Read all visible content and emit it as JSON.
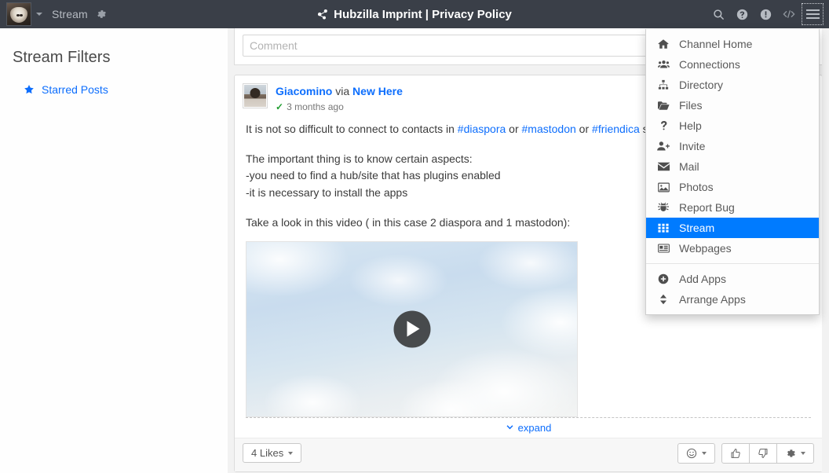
{
  "header": {
    "brand_avatar_alt": "channel-avatar",
    "nav_label": "Stream",
    "gear_icon": "gear-icon",
    "caret_icon": "caret-down-icon",
    "title": "Hubzilla Imprint | Privacy Policy",
    "title_icon": "share-nodes-icon",
    "icons": [
      {
        "name": "search-icon",
        "glyph": "search"
      },
      {
        "name": "help-icon",
        "glyph": "question-circle"
      },
      {
        "name": "info-icon",
        "glyph": "exclamation-circle"
      },
      {
        "name": "code-icon",
        "glyph": "code"
      },
      {
        "name": "hamburger-menu-icon",
        "glyph": "bars"
      }
    ],
    "bg_color": "#3a3f48",
    "text_color": "#b6bbc2"
  },
  "sidebar": {
    "title": "Stream Filters",
    "items": [
      {
        "label": "Starred Posts",
        "icon": "star-icon",
        "icon_color": "#0d6efd"
      }
    ]
  },
  "comment_box": {
    "placeholder": "Comment",
    "value": ""
  },
  "post": {
    "author": "Giacomino",
    "via_text": "via",
    "source": "New Here",
    "verified_icon": "check-icon",
    "timestamp": "3 months ago",
    "body": {
      "line1_prefix": "It is not so difficult to connect to contacts in ",
      "tag1": "#diaspora",
      "sep1": " or ",
      "tag2": "#mastodon",
      "sep2": " or ",
      "tag3": "#friendica",
      "line1_suffix": " st",
      "line2": "The important thing is to know certain aspects:",
      "line3": "-you need to find a hub/site that has plugins enabled",
      "line4": "-it is necessary to install the apps",
      "line5": "Take a look in this video ( in this case 2 diaspora and 1 mastodon):"
    },
    "video": {
      "play_icon": "play-icon",
      "thumbnail_description": "sky-with-clouds"
    },
    "expand_label": "expand",
    "expand_icon": "chevron-down-icon",
    "likes_label": "4 Likes",
    "actions": [
      {
        "name": "emoji-reaction-button",
        "icon": "smiley-icon",
        "has_caret": true
      },
      {
        "name": "like-button",
        "icon": "thumbs-up-icon",
        "has_caret": false
      },
      {
        "name": "dislike-button",
        "icon": "thumbs-down-icon",
        "has_caret": false
      },
      {
        "name": "post-settings-button",
        "icon": "gear-icon",
        "has_caret": true
      }
    ]
  },
  "app_menu": {
    "highlight_color": "#007bff",
    "items": [
      {
        "label": "Channel Home",
        "icon": "home-icon",
        "active": false
      },
      {
        "label": "Connections",
        "icon": "users-icon",
        "active": false
      },
      {
        "label": "Directory",
        "icon": "sitemap-icon",
        "active": false
      },
      {
        "label": "Files",
        "icon": "folder-icon",
        "active": false
      },
      {
        "label": "Help",
        "icon": "question-icon",
        "active": false
      },
      {
        "label": "Invite",
        "icon": "user-plus-icon",
        "active": false
      },
      {
        "label": "Mail",
        "icon": "envelope-icon",
        "active": false
      },
      {
        "label": "Photos",
        "icon": "image-icon",
        "active": false
      },
      {
        "label": "Report Bug",
        "icon": "bug-icon",
        "active": false
      },
      {
        "label": "Stream",
        "icon": "grid-icon",
        "active": true
      },
      {
        "label": "Webpages",
        "icon": "newspaper-icon",
        "active": false
      }
    ],
    "footer_items": [
      {
        "label": "Add Apps",
        "icon": "plus-circle-icon"
      },
      {
        "label": "Arrange Apps",
        "icon": "sort-icon"
      }
    ]
  }
}
